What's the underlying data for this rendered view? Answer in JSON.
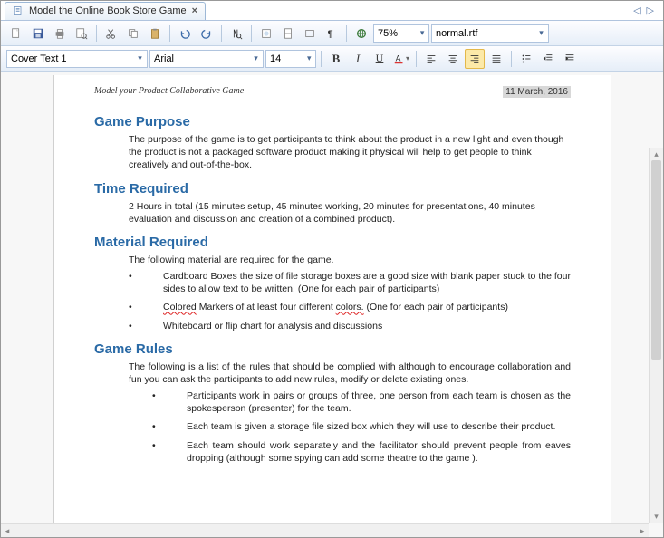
{
  "tab": {
    "title": "Model the Online Book Store Game",
    "close": "×"
  },
  "toolbar": {
    "zoom": "75%",
    "template": "normal.rtf",
    "style": "Cover Text 1",
    "font": "Arial",
    "fontsize": "14"
  },
  "doc": {
    "header_left": "Model your Product Collaborative Game",
    "header_date": "11 March, 2016",
    "sections": {
      "purpose": {
        "title": "Game Purpose",
        "body": "The purpose of the game is to get participants to think about the product in a new light and even though the product is not a packaged software product making it physical will help to get people to think creatively and out-of-the-box."
      },
      "time": {
        "title": "Time Required",
        "body": "2 Hours in total (15 minutes setup, 45 minutes working, 20 minutes for presentations, 40 minutes evaluation and discussion and creation of a combined product)."
      },
      "material": {
        "title": "Material Required",
        "intro": "The following material are required for the game.",
        "b1a": "Cardboard Boxes the size of file storage boxes are a good size with blank paper stuck to the four sides to allow text to be written. (One for each pair of participants)",
        "b2a": "Colored",
        "b2b": " Markers of at least four different ",
        "b2c": "colors.",
        "b2d": " (One for each pair of participants)",
        "b3": "Whiteboard or flip chart for analysis and discussions"
      },
      "rules": {
        "title": "Game Rules",
        "intro": "The following is a list of the rules that should be complied with although to encourage collaboration and fun you can ask the participants to add new rules, modify or delete existing ones.",
        "b1": "Participants work in pairs or groups of three, one person from each team is chosen as the spokesperson (presenter) for the team.",
        "b2": "Each team is given a storage file sized box which they will use to describe their product.",
        "b3": "Each team should work separately and the facilitator should prevent people from eaves dropping (although some spying can add some theatre to the game )."
      }
    }
  }
}
